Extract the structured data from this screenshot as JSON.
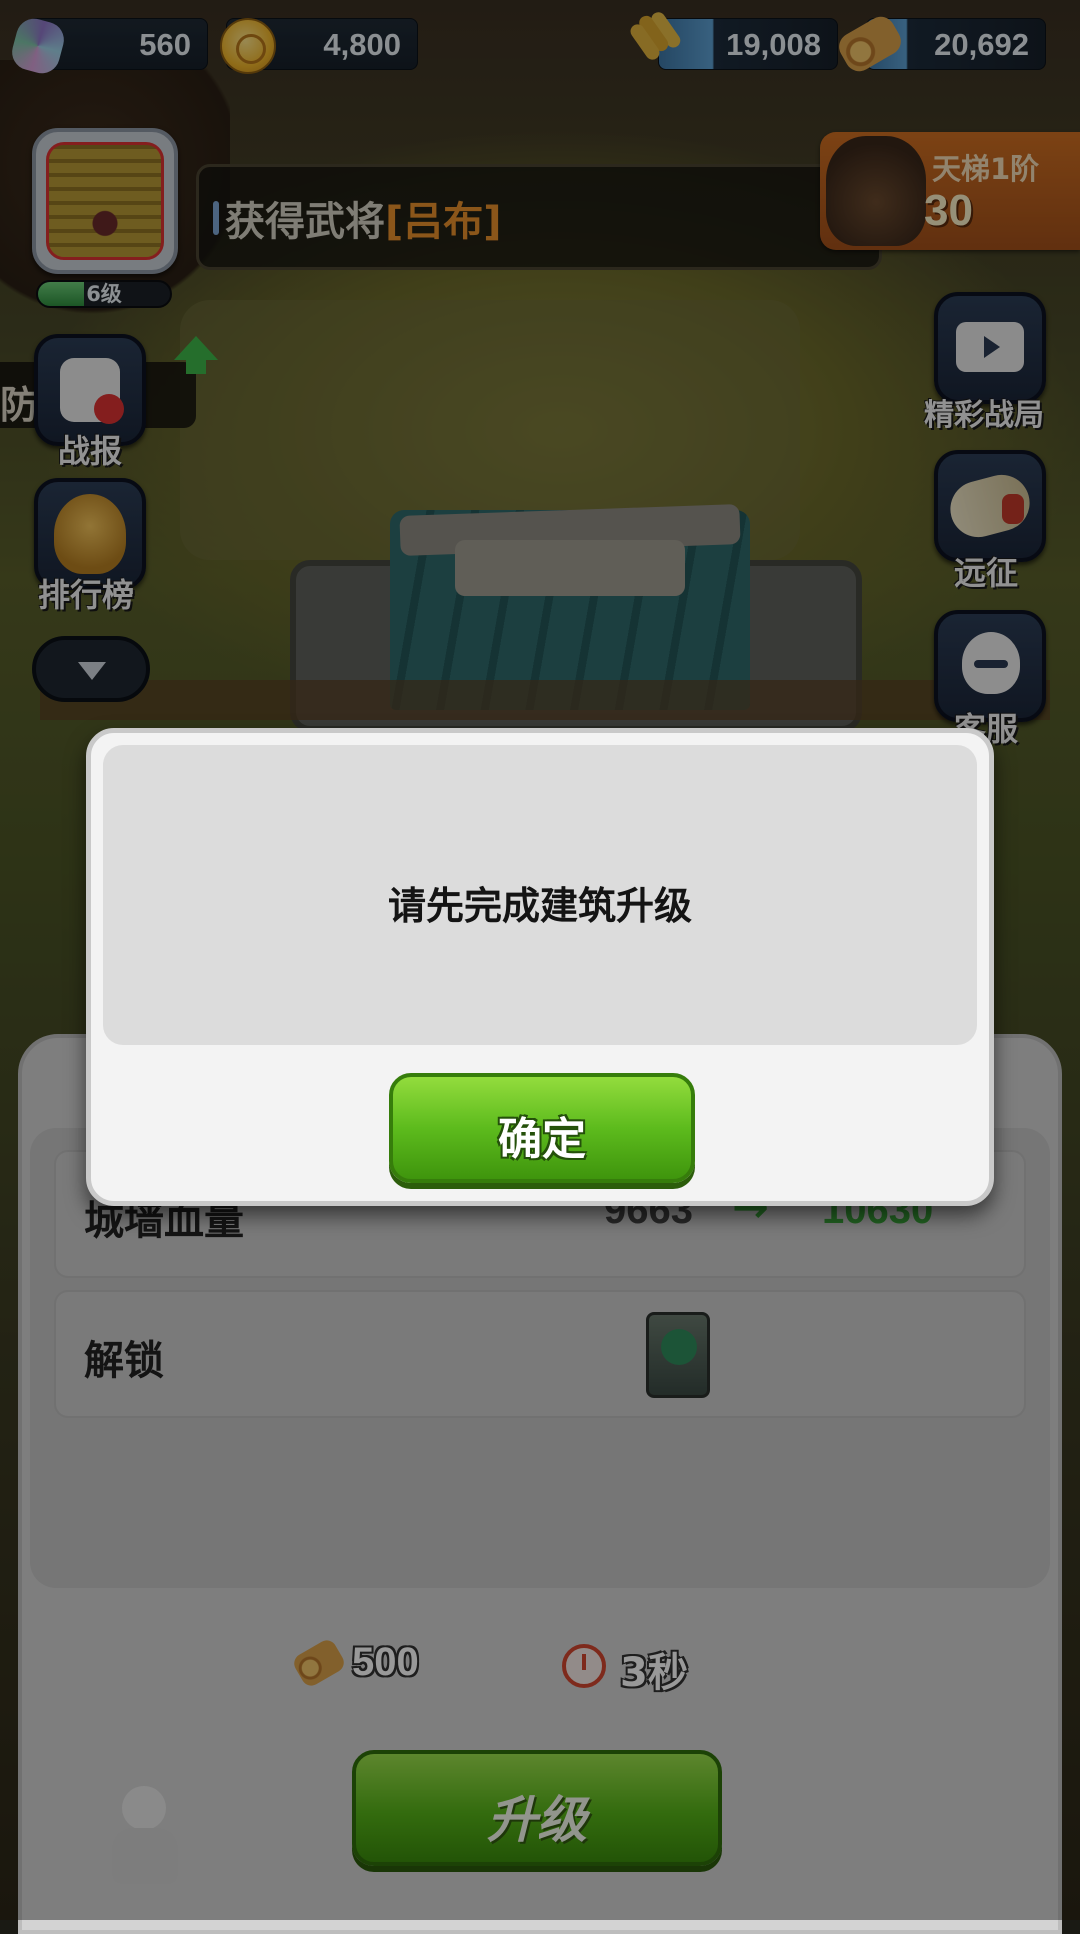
{
  "resources": {
    "gems": "560",
    "coins": "4,800",
    "food": "19,008",
    "wood": "20,692"
  },
  "player": {
    "level": "6级",
    "level_progress": 0.35
  },
  "notice": {
    "prefix": "获得武将",
    "name": "[吕布]"
  },
  "ladder": {
    "title": "天梯1阶",
    "score": "30"
  },
  "left_menu": {
    "peek": "防",
    "report": "战报",
    "rank": "排行榜"
  },
  "right_menu": {
    "highlights": "精彩战局",
    "expedition": "远征",
    "service": "客服"
  },
  "panel": {
    "rows": [
      {
        "label": "城墙血量",
        "old": "9663",
        "arrow": "→",
        "new": "10630"
      },
      {
        "label": "解锁"
      }
    ],
    "cost": "500",
    "time": "3秒",
    "upgrade_label": "升级"
  },
  "dialog": {
    "message": "请先完成建筑升级",
    "confirm_label": "确定"
  },
  "icons": {
    "gem": "gem-icon",
    "coin": "coin-icon",
    "food": "wheat-icon",
    "wood": "log-icon",
    "time": "clock-icon"
  },
  "colors": {
    "accent_green": "#5dbb1d",
    "notice_name": "#e88f2c",
    "ladder_orange": "#cf6f22"
  }
}
